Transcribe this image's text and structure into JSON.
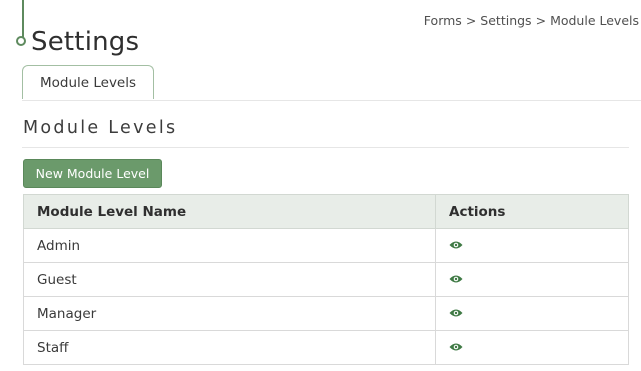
{
  "header": {
    "title": "Settings",
    "breadcrumb": [
      "Forms",
      "Settings",
      "Module Levels"
    ],
    "breadcrumb_separator": ">"
  },
  "tabs": [
    {
      "label": "Module Levels",
      "active": true
    }
  ],
  "section": {
    "title": "Module Levels",
    "new_button_label": "New Module Level"
  },
  "table": {
    "columns": [
      "Module Level Name",
      "Actions"
    ],
    "rows": [
      {
        "name": "Admin",
        "action_icon": "eye-icon"
      },
      {
        "name": "Guest",
        "action_icon": "eye-icon"
      },
      {
        "name": "Manager",
        "action_icon": "eye-icon"
      },
      {
        "name": "Staff",
        "action_icon": "eye-icon"
      }
    ]
  },
  "colors": {
    "accent": "#6b9a6b",
    "tab_border": "#a3bfa3",
    "table_header_bg": "#e8ede8",
    "eye_icon": "#3f7a45"
  }
}
